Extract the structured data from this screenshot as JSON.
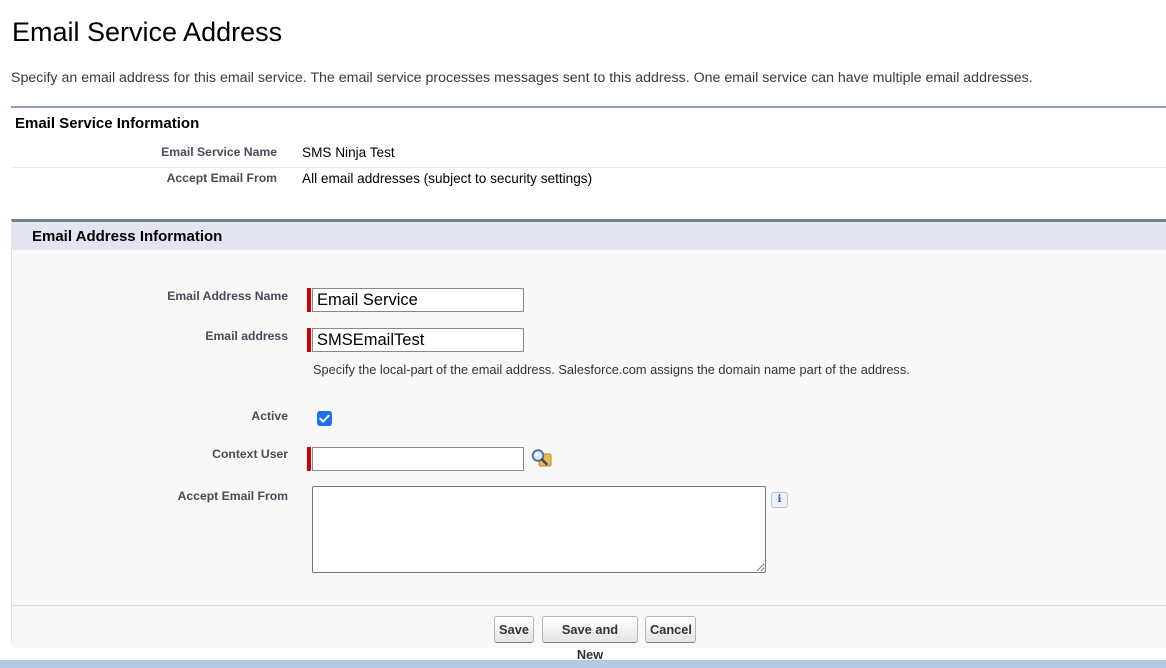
{
  "page": {
    "title": "Email Service Address",
    "description": "Specify an email address for this email service. The email service processes messages sent to this address. One email service can have multiple email addresses."
  },
  "service_info": {
    "header": "Email Service Information",
    "rows": [
      {
        "label": "Email Service Name",
        "value": "SMS Ninja Test"
      },
      {
        "label": "Accept Email From",
        "value": "All email addresses (subject to security settings)"
      }
    ]
  },
  "address_info": {
    "header": "Email Address Information",
    "email_address_name": {
      "label": "Email Address Name",
      "value": "Email Service",
      "required": true
    },
    "email_address": {
      "label": "Email address",
      "value": "SMSEmailTest",
      "required": true,
      "help": "Specify the local-part of the email address. Salesforce.com assigns the domain name part of the address."
    },
    "active": {
      "label": "Active",
      "checked": true
    },
    "context_user": {
      "label": "Context User",
      "value": "",
      "required": true,
      "icon": "lookup-magnifier-icon"
    },
    "accept_email_from": {
      "label": "Accept Email From",
      "value": "",
      "info_icon": "i"
    }
  },
  "buttons": {
    "save": "Save",
    "save_and_new": "Save and New",
    "cancel": "Cancel"
  },
  "colors": {
    "required_bar": "#cc0000",
    "checkbox": "#1a73e8",
    "section_border": "#747e96",
    "section_header_bg": "#e2e5ef",
    "footer_strip": "#b6c7e0"
  }
}
